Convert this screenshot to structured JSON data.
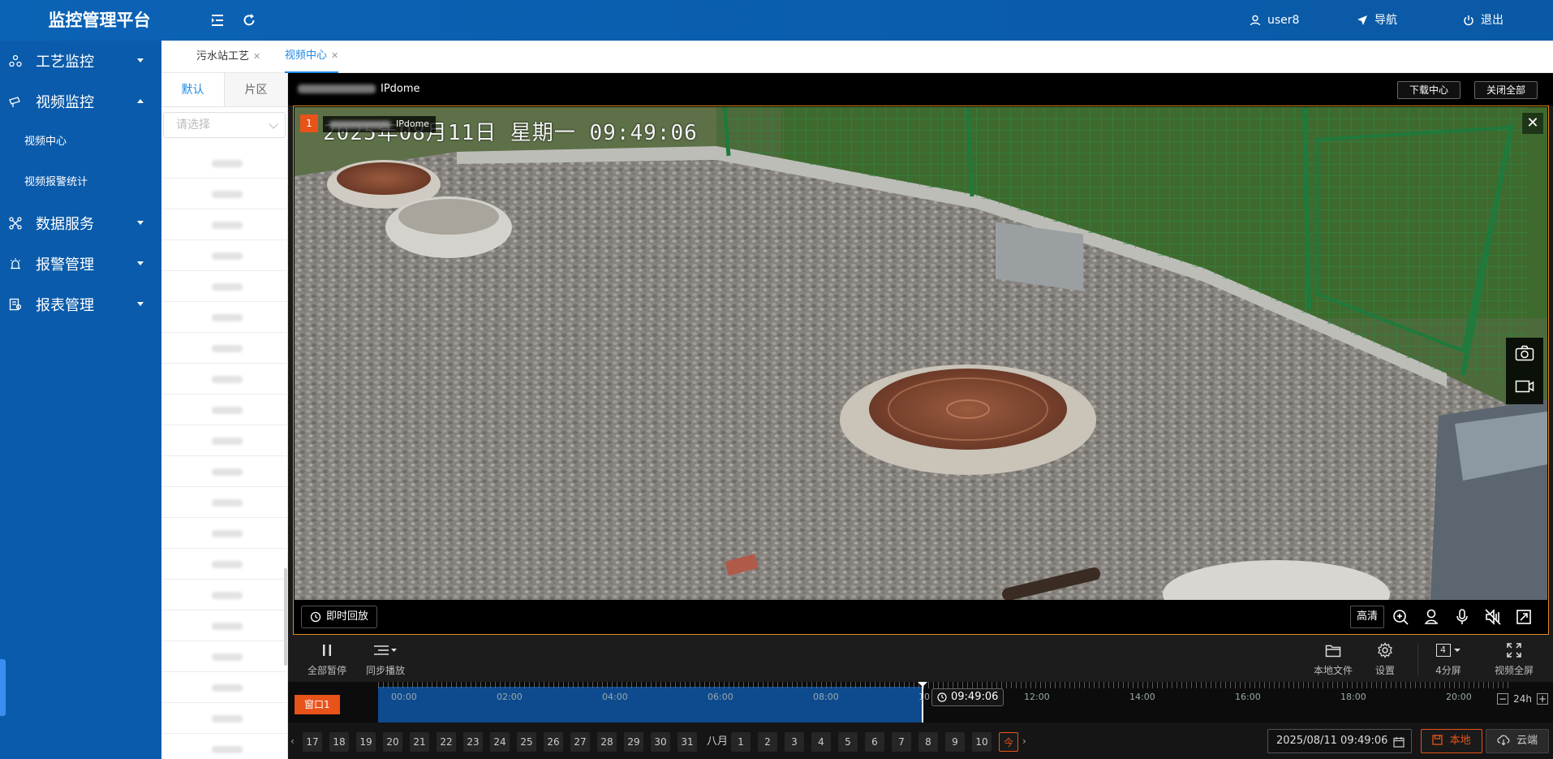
{
  "header": {
    "brand": "监控管理平台",
    "user": "user8",
    "nav": "导航",
    "logout": "退出"
  },
  "sidebar": {
    "items": [
      {
        "label": "工艺监控",
        "icon": "process-icon",
        "expanded": false
      },
      {
        "label": "视频监控",
        "icon": "video-icon",
        "expanded": true,
        "children": [
          "视频中心",
          "视频报警统计"
        ]
      },
      {
        "label": "数据服务",
        "icon": "data-icon",
        "expanded": false
      },
      {
        "label": "报警管理",
        "icon": "alarm-icon",
        "expanded": false
      },
      {
        "label": "报表管理",
        "icon": "report-icon",
        "expanded": false
      }
    ]
  },
  "tabs": [
    {
      "label": "污水站工艺",
      "active": false
    },
    {
      "label": "视频中心",
      "active": true
    }
  ],
  "device_panel": {
    "tabs": [
      "默认",
      "片区"
    ],
    "select_placeholder": "请选择",
    "row_count": 20
  },
  "video": {
    "channel_name": "IPdome",
    "download_center": "下载中心",
    "close_all": "关闭全部",
    "window_number": "1",
    "window_label": "IPdome",
    "osd_text": "2025年08月11日  星期一  09:49:06",
    "instant_replay": "即时回放",
    "quality": "高清"
  },
  "controls": {
    "pause_all": "全部暂停",
    "sync_play": "同步播放",
    "local_file": "本地文件",
    "settings": "设置",
    "split_value": "4",
    "split_label": "4分屏",
    "fullscreen": "视频全屏"
  },
  "timeline": {
    "window_tag": "窗口1",
    "hours": [
      "00:00",
      "02:00",
      "04:00",
      "06:00",
      "08:00",
      "10",
      "12:00",
      "14:00",
      "16:00",
      "18:00",
      "20:00"
    ],
    "current_time": "09:49:06",
    "progress_hours": 9.8183,
    "zoom_label": "24h"
  },
  "datebar": {
    "days_before": [
      "17",
      "18",
      "19",
      "20",
      "21",
      "22",
      "23",
      "24",
      "25",
      "26",
      "27",
      "28",
      "29",
      "30",
      "31"
    ],
    "month_label": "八月",
    "days_after": [
      "1",
      "2",
      "3",
      "4",
      "5",
      "6",
      "7",
      "8",
      "9",
      "10"
    ],
    "today_label": "今",
    "datetime": "2025/08/11 09:49:06",
    "local_btn": "本地",
    "cloud_btn": "云端"
  },
  "colors": {
    "header_bg": "#0b63b5",
    "sidebar_bg": "#0a5bab",
    "accent": "#1e88e5",
    "active_orange": "#e8531a",
    "timeline_fill": "#0e4a8e"
  }
}
